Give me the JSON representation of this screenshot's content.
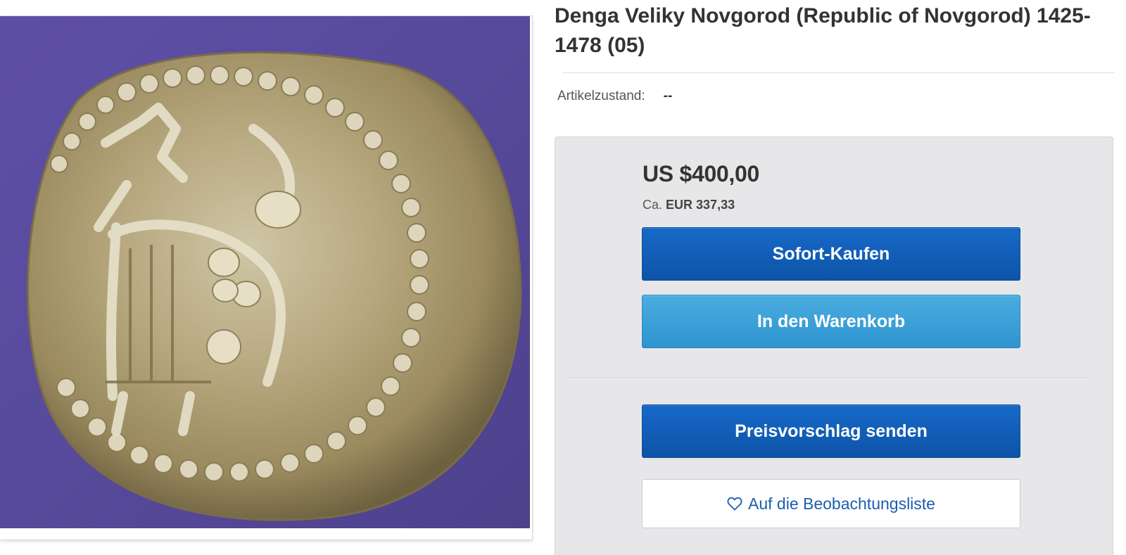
{
  "listing": {
    "title": "Denga Veliky Novgorod (Republic of Novgorod) 1425-1478 (05)",
    "condition_label": "Artikelzustand:",
    "condition_value": "--"
  },
  "pricing": {
    "price": "US $400,00",
    "converted_prefix": "Ca.",
    "converted_amount": "EUR 337,33"
  },
  "actions": {
    "buy_now": "Sofort-Kaufen",
    "add_to_cart": "In den Warenkorb",
    "make_offer": "Preisvorschlag senden",
    "watchlist": "Auf die Beobachtungsliste"
  },
  "icons": {
    "watchlist_icon": "heart-icon"
  },
  "colors": {
    "primary_button": "#0f5bb0",
    "secondary_button": "#3aa0d8",
    "link_blue": "#1b5eb0",
    "buy_box_bg": "#e7e7e9",
    "image_background": "#5a4a9e"
  }
}
